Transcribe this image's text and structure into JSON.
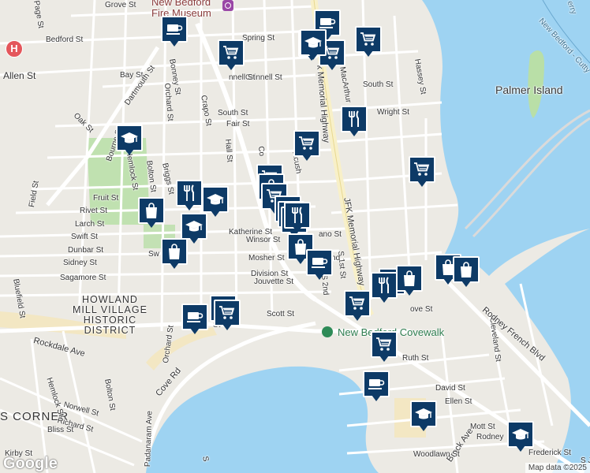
{
  "map": {
    "title": "",
    "colors": {
      "land": "#eceae4",
      "water": "#9ed3f2",
      "park": "#b9dfa7",
      "sand": "#f3e7c3",
      "road": "#ffffff",
      "highway": "#f8f0c8",
      "marker": "#0d3a66",
      "hospital": "#e4565b",
      "museum": "#9a47a6",
      "park_pin": "#2e8b57"
    },
    "street_labels": [
      {
        "text": "Grove St"
      },
      {
        "text": "Bedford St"
      },
      {
        "text": "Allen St"
      },
      {
        "text": "Bay St"
      },
      {
        "text": "Oak St"
      },
      {
        "text": "Dartmouth St"
      },
      {
        "text": "Bonney St"
      },
      {
        "text": "Orchard St"
      },
      {
        "text": "Crapo St"
      },
      {
        "text": "South St"
      },
      {
        "text": "Fair St"
      },
      {
        "text": "Hall St"
      },
      {
        "text": "Grinnell St"
      },
      {
        "text": "Spring St"
      },
      {
        "text": "Co"
      },
      {
        "text": "Acush"
      },
      {
        "text": "Hemlock St"
      },
      {
        "text": "Bolton St"
      },
      {
        "text": "Briggs St"
      },
      {
        "text": "Bourne St"
      },
      {
        "text": "Fruit St"
      },
      {
        "text": "Field St"
      },
      {
        "text": "Rivet St"
      },
      {
        "text": "Larch St"
      },
      {
        "text": "Swift St"
      },
      {
        "text": "Dunbar St"
      },
      {
        "text": "Sidney St"
      },
      {
        "text": "Sagamore St"
      },
      {
        "text": "Katherine St"
      },
      {
        "text": "Winsor St"
      },
      {
        "text": "Mosher St"
      },
      {
        "text": "Division St"
      },
      {
        "text": "Jouvette St"
      },
      {
        "text": "Scott St"
      },
      {
        "text": "Rockdale Ave"
      },
      {
        "text": "Cove Rd"
      },
      {
        "text": "Orchard St"
      },
      {
        "text": "Bluefield St"
      },
      {
        "text": "Hemlock St"
      },
      {
        "text": "Bolton St"
      },
      {
        "text": "Norwell St"
      },
      {
        "text": "Richard St"
      },
      {
        "text": "Bliss St"
      },
      {
        "text": "Kirby St"
      },
      {
        "text": "Padanaram Ave"
      },
      {
        "text": "South St"
      },
      {
        "text": "Wright St"
      },
      {
        "text": "MacArthur"
      },
      {
        "text": "Hassey St"
      },
      {
        "text": "JFK Memorial Highway"
      },
      {
        "text": "k Memorial Highway"
      },
      {
        "text": "S 1st St"
      },
      {
        "text": "S 2nd"
      },
      {
        "text": "ano St"
      },
      {
        "text": "Ruth St"
      },
      {
        "text": "David St"
      },
      {
        "text": "Ellen St"
      },
      {
        "text": "Mott St"
      },
      {
        "text": "Cleveland St"
      },
      {
        "text": "Brock Ave"
      },
      {
        "text": "Rodney French Blvd"
      },
      {
        "text": "Rodney"
      },
      {
        "text": "Woodlawn St"
      },
      {
        "text": "Frederick St"
      },
      {
        "text": "ove St"
      },
      {
        "text": "S 2nd"
      },
      {
        "text": "Page St"
      },
      {
        "text": "Sw"
      },
      {
        "text": "St"
      },
      {
        "text": "S J"
      },
      {
        "text": "S"
      },
      {
        "text": "nnell St"
      }
    ],
    "place_labels": {
      "museum": "New Bedford\nFire Museum",
      "island": "Palmer Island",
      "district": "HOWLAND\nMILL VILLAGE\nHISTORIC\nDISTRICT",
      "covewalk": "New Bedford Covewalk",
      "corner": "S CORNER",
      "ferry": "New Bedford - Cutty",
      "ferry2": "erry"
    },
    "hospital_letter": "H",
    "logo": "Google",
    "attribution": "Map data ©2025"
  },
  "markers": [
    {
      "icon": "coffee-icon"
    },
    {
      "icon": "coffee-icon"
    },
    {
      "icon": "cart-icon"
    },
    {
      "icon": "cart-icon"
    },
    {
      "icon": "cart-icon"
    },
    {
      "icon": "school-icon"
    },
    {
      "icon": "cart-icon"
    },
    {
      "icon": "restaurant-icon"
    },
    {
      "icon": "cart-icon"
    },
    {
      "icon": "school-icon"
    },
    {
      "icon": "cart-icon"
    },
    {
      "icon": "cart-icon"
    },
    {
      "icon": "shopping-bag-icon"
    },
    {
      "icon": "cart-icon"
    },
    {
      "icon": "restaurant-icon"
    },
    {
      "icon": "school-icon"
    },
    {
      "icon": "shopping-bag-icon"
    },
    {
      "icon": "school-icon"
    },
    {
      "icon": "shopping-bag-icon"
    },
    {
      "icon": "cart-icon"
    },
    {
      "icon": "cart-icon"
    },
    {
      "icon": "cart-icon"
    },
    {
      "icon": "restaurant-icon"
    },
    {
      "icon": "shopping-bag-icon"
    },
    {
      "icon": "coffee-icon"
    },
    {
      "icon": "shopping-bag-icon"
    },
    {
      "icon": "shopping-bag-icon"
    },
    {
      "icon": "cart-icon"
    },
    {
      "icon": "restaurant-icon"
    },
    {
      "icon": "shopping-bag-icon"
    },
    {
      "icon": "cart-icon"
    },
    {
      "icon": "coffee-icon"
    },
    {
      "icon": "cart-icon"
    },
    {
      "icon": "cart-icon"
    },
    {
      "icon": "cart-icon"
    },
    {
      "icon": "coffee-icon"
    },
    {
      "icon": "school-icon"
    },
    {
      "icon": "school-icon"
    }
  ]
}
